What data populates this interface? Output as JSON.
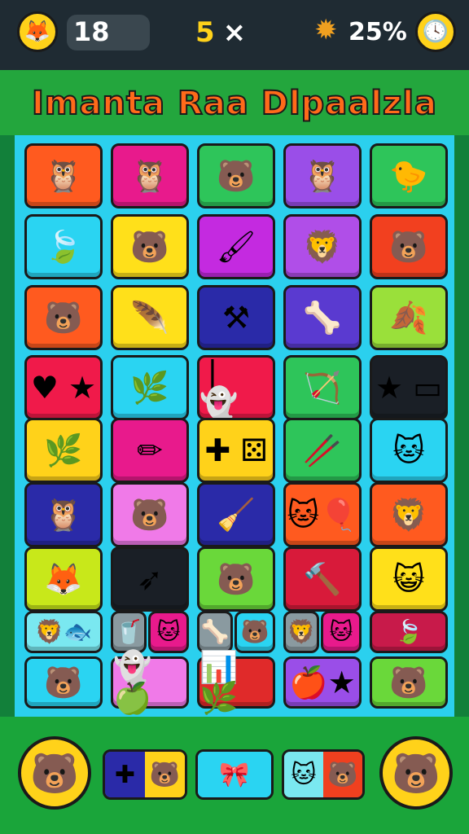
{
  "hud": {
    "left_icon": "fox-icon",
    "score": "18",
    "moves": "5",
    "moves_symbol": "×",
    "progress_icon": "sun-star-icon",
    "progress_text": "25%",
    "right_icon": "clock-icon"
  },
  "title": "Imanta Raa Dlpaalzla",
  "colors": {
    "board_bg": "#2bd0ee",
    "title_band": "#23a63d",
    "hud_bg": "#1f2b33",
    "accent_yellow": "#ffd21a"
  },
  "tiles": [
    {
      "name": "tile-owl-orange",
      "bg": "#ff5a1f",
      "icon": "owl-icon",
      "glyph": "🦉"
    },
    {
      "name": "tile-owl-magenta",
      "bg": "#e81a8c",
      "icon": "owl-icon",
      "glyph": "🦉"
    },
    {
      "name": "tile-bear-green",
      "bg": "#2ec55a",
      "icon": "bear-icon",
      "glyph": "🐻"
    },
    {
      "name": "tile-owl-purple",
      "bg": "#9a4ee8",
      "icon": "owl-icon",
      "glyph": "🦉"
    },
    {
      "name": "tile-bird-green",
      "bg": "#2ec55a",
      "icon": "bird-icon",
      "glyph": "🐤"
    },
    {
      "name": "tile-leaf-cyan",
      "bg": "#2ad4f2",
      "icon": "leaf-icon",
      "glyph": "🍃"
    },
    {
      "name": "tile-bear-yellow",
      "bg": "#ffe01a",
      "icon": "bear-icon",
      "glyph": "🐻"
    },
    {
      "name": "tile-brush-magenta",
      "bg": "#c42ae0",
      "icon": "brush-icon",
      "glyph": "🖌"
    },
    {
      "name": "tile-lion-purple",
      "bg": "#b04ee8",
      "icon": "lion-icon",
      "glyph": "🦁"
    },
    {
      "name": "tile-bear-red",
      "bg": "#f2401f",
      "icon": "bear-icon",
      "glyph": "🐻"
    },
    {
      "name": "tile-bear-orange",
      "bg": "#ff5a1f",
      "icon": "bear-icon",
      "glyph": "🐻"
    },
    {
      "name": "tile-feather-yellow",
      "bg": "#ffe01a",
      "icon": "feather-icon",
      "glyph": "🪶"
    },
    {
      "name": "tile-tools-navy",
      "bg": "#2a2aa8",
      "icon": "crossed-tools-icon",
      "glyph": "⚒"
    },
    {
      "name": "tile-bones-purple",
      "bg": "#5a3ad0",
      "icon": "crossed-bones-icon",
      "glyph": "🦴"
    },
    {
      "name": "tile-leaf-lime",
      "bg": "#9ae03a",
      "icon": "leaf-icon",
      "glyph": "🍂"
    },
    {
      "name": "tile-heart-star-red",
      "bg": "#f01a4a",
      "icon": "heart-star-icon",
      "glyph": "♥ ★"
    },
    {
      "name": "tile-branches-cyan",
      "bg": "#2ad4f2",
      "icon": "branches-icon",
      "glyph": "🌿"
    },
    {
      "name": "tile-ghost-red",
      "bg": "#f01a4a",
      "icon": "ghost-icon",
      "glyph": "❘ 👻"
    },
    {
      "name": "tile-arrow-green",
      "bg": "#2ec55a",
      "icon": "arrow-icon",
      "glyph": "🏹"
    },
    {
      "name": "tile-star-black",
      "bg": "#1a1f26",
      "icon": "star-box-icon",
      "glyph": "★ ▭"
    },
    {
      "name": "tile-feather-yellow-2",
      "bg": "#ffd21a",
      "icon": "feather-icon",
      "glyph": "🌿"
    },
    {
      "name": "tile-pencil-magenta",
      "bg": "#e81a8c",
      "icon": "pencil-icon",
      "glyph": "✏"
    },
    {
      "name": "tile-dice-yellow",
      "bg": "#ffd21a",
      "icon": "dice-icon",
      "glyph": "✚ ⚄"
    },
    {
      "name": "tile-sticks-green",
      "bg": "#2ec55a",
      "icon": "sticks-icon",
      "glyph": "🥢"
    },
    {
      "name": "tile-cat-cyan",
      "bg": "#2ad4f2",
      "icon": "cat-icon",
      "glyph": "🐱"
    },
    {
      "name": "tile-owl-navy",
      "bg": "#2a2aa8",
      "icon": "owl-icon",
      "glyph": "🦉"
    },
    {
      "name": "tile-bear-pink",
      "bg": "#f07ae8",
      "icon": "bear-icon",
      "glyph": "🐻"
    },
    {
      "name": "tile-broom-navy",
      "bg": "#2a2aa8",
      "icon": "broom-icon",
      "glyph": "🧹"
    },
    {
      "name": "tile-cat-balloon-orange",
      "bg": "#ff5a1f",
      "icon": "cat-balloon-icon",
      "glyph": "🐱🎈"
    },
    {
      "name": "tile-lion-orange",
      "bg": "#ff5a1f",
      "icon": "lion-icon",
      "glyph": "🦁"
    },
    {
      "name": "tile-fox-lime",
      "bg": "#c8e81a",
      "icon": "fox-icon",
      "glyph": "🦊"
    },
    {
      "name": "tile-arrows-black",
      "bg": "#1a1f26",
      "icon": "arrows-icon",
      "glyph": "➶"
    },
    {
      "name": "tile-bear-green-2",
      "bg": "#6ad83a",
      "icon": "bear-icon",
      "glyph": "🐻"
    },
    {
      "name": "tile-hammer-red",
      "bg": "#d81a3a",
      "icon": "hammer-icon",
      "glyph": "🔨"
    },
    {
      "name": "tile-cat-yellow",
      "bg": "#ffe01a",
      "icon": "cat-icon",
      "glyph": "😺"
    }
  ],
  "half_rows": [
    [
      {
        "name": "tile-lion-fish-cyan",
        "bg": "#7ae8f0",
        "icon": "lion-fish-icon",
        "glyph": "🦁🐟"
      },
      {
        "name": "tile-cup-gray",
        "bg": "#8a9aa0",
        "icon": "cup-icon",
        "glyph": "🥤"
      },
      {
        "name": "tile-cat-magenta",
        "bg": "#e81a8c",
        "icon": "cat-icon",
        "glyph": "🐱"
      },
      {
        "name": "tile-bones-gray",
        "bg": "#8a9aa0",
        "icon": "bones-icon",
        "glyph": "🦴"
      },
      {
        "name": "tile-bear-cyan",
        "bg": "#2ad4f2",
        "icon": "bear-icon",
        "glyph": "🐻"
      },
      {
        "name": "tile-lion-gray",
        "bg": "#8a9aa0",
        "icon": "lion-icon",
        "glyph": "🦁"
      },
      {
        "name": "tile-cat-pink",
        "bg": "#e81a8c",
        "icon": "cat-icon",
        "glyph": "🐱"
      },
      {
        "name": "tile-leaves-crimson",
        "bg": "#c81a4a",
        "icon": "leaves-icon",
        "glyph": "🍃"
      }
    ],
    [
      {
        "name": "tile-bear-cyan-2",
        "bg": "#2ad4f2",
        "icon": "bear-icon",
        "glyph": "🐻"
      },
      {
        "name": "tile-ghost-apple-pink",
        "bg": "#f07ae8",
        "icon": "ghost-apple-icon",
        "glyph": "👻🍏"
      },
      {
        "name": "tile-chart-plant-red",
        "bg": "#e02a2a",
        "icon": "chart-plant-icon",
        "glyph": "📊🌿"
      },
      {
        "name": "tile-apple-star-purple",
        "bg": "#9a4ee8",
        "icon": "apple-star-icon",
        "glyph": "🍎★"
      },
      {
        "name": "tile-bear-lime",
        "bg": "#6ad83a",
        "icon": "bear-icon",
        "glyph": "🐻"
      }
    ]
  ],
  "tray": {
    "left_button_icon": "bear-face-icon",
    "left_button_glyph": "🐻",
    "right_button_icon": "bear-face-icon",
    "right_button_glyph": "🐻",
    "slots": [
      {
        "name": "tray-slot-1",
        "segments": [
          {
            "bg": "#2a2aa8",
            "glyph": "✚"
          },
          {
            "bg": "#ffd21a",
            "glyph": "🐻"
          }
        ]
      },
      {
        "name": "tray-slot-2",
        "segments": [
          {
            "bg": "#2ad4f2",
            "glyph": "🎀"
          }
        ]
      },
      {
        "name": "tray-slot-3",
        "segments": [
          {
            "bg": "#7ae8f0",
            "glyph": "🐱"
          },
          {
            "bg": "#f0401f",
            "glyph": "🐻"
          }
        ]
      }
    ]
  }
}
